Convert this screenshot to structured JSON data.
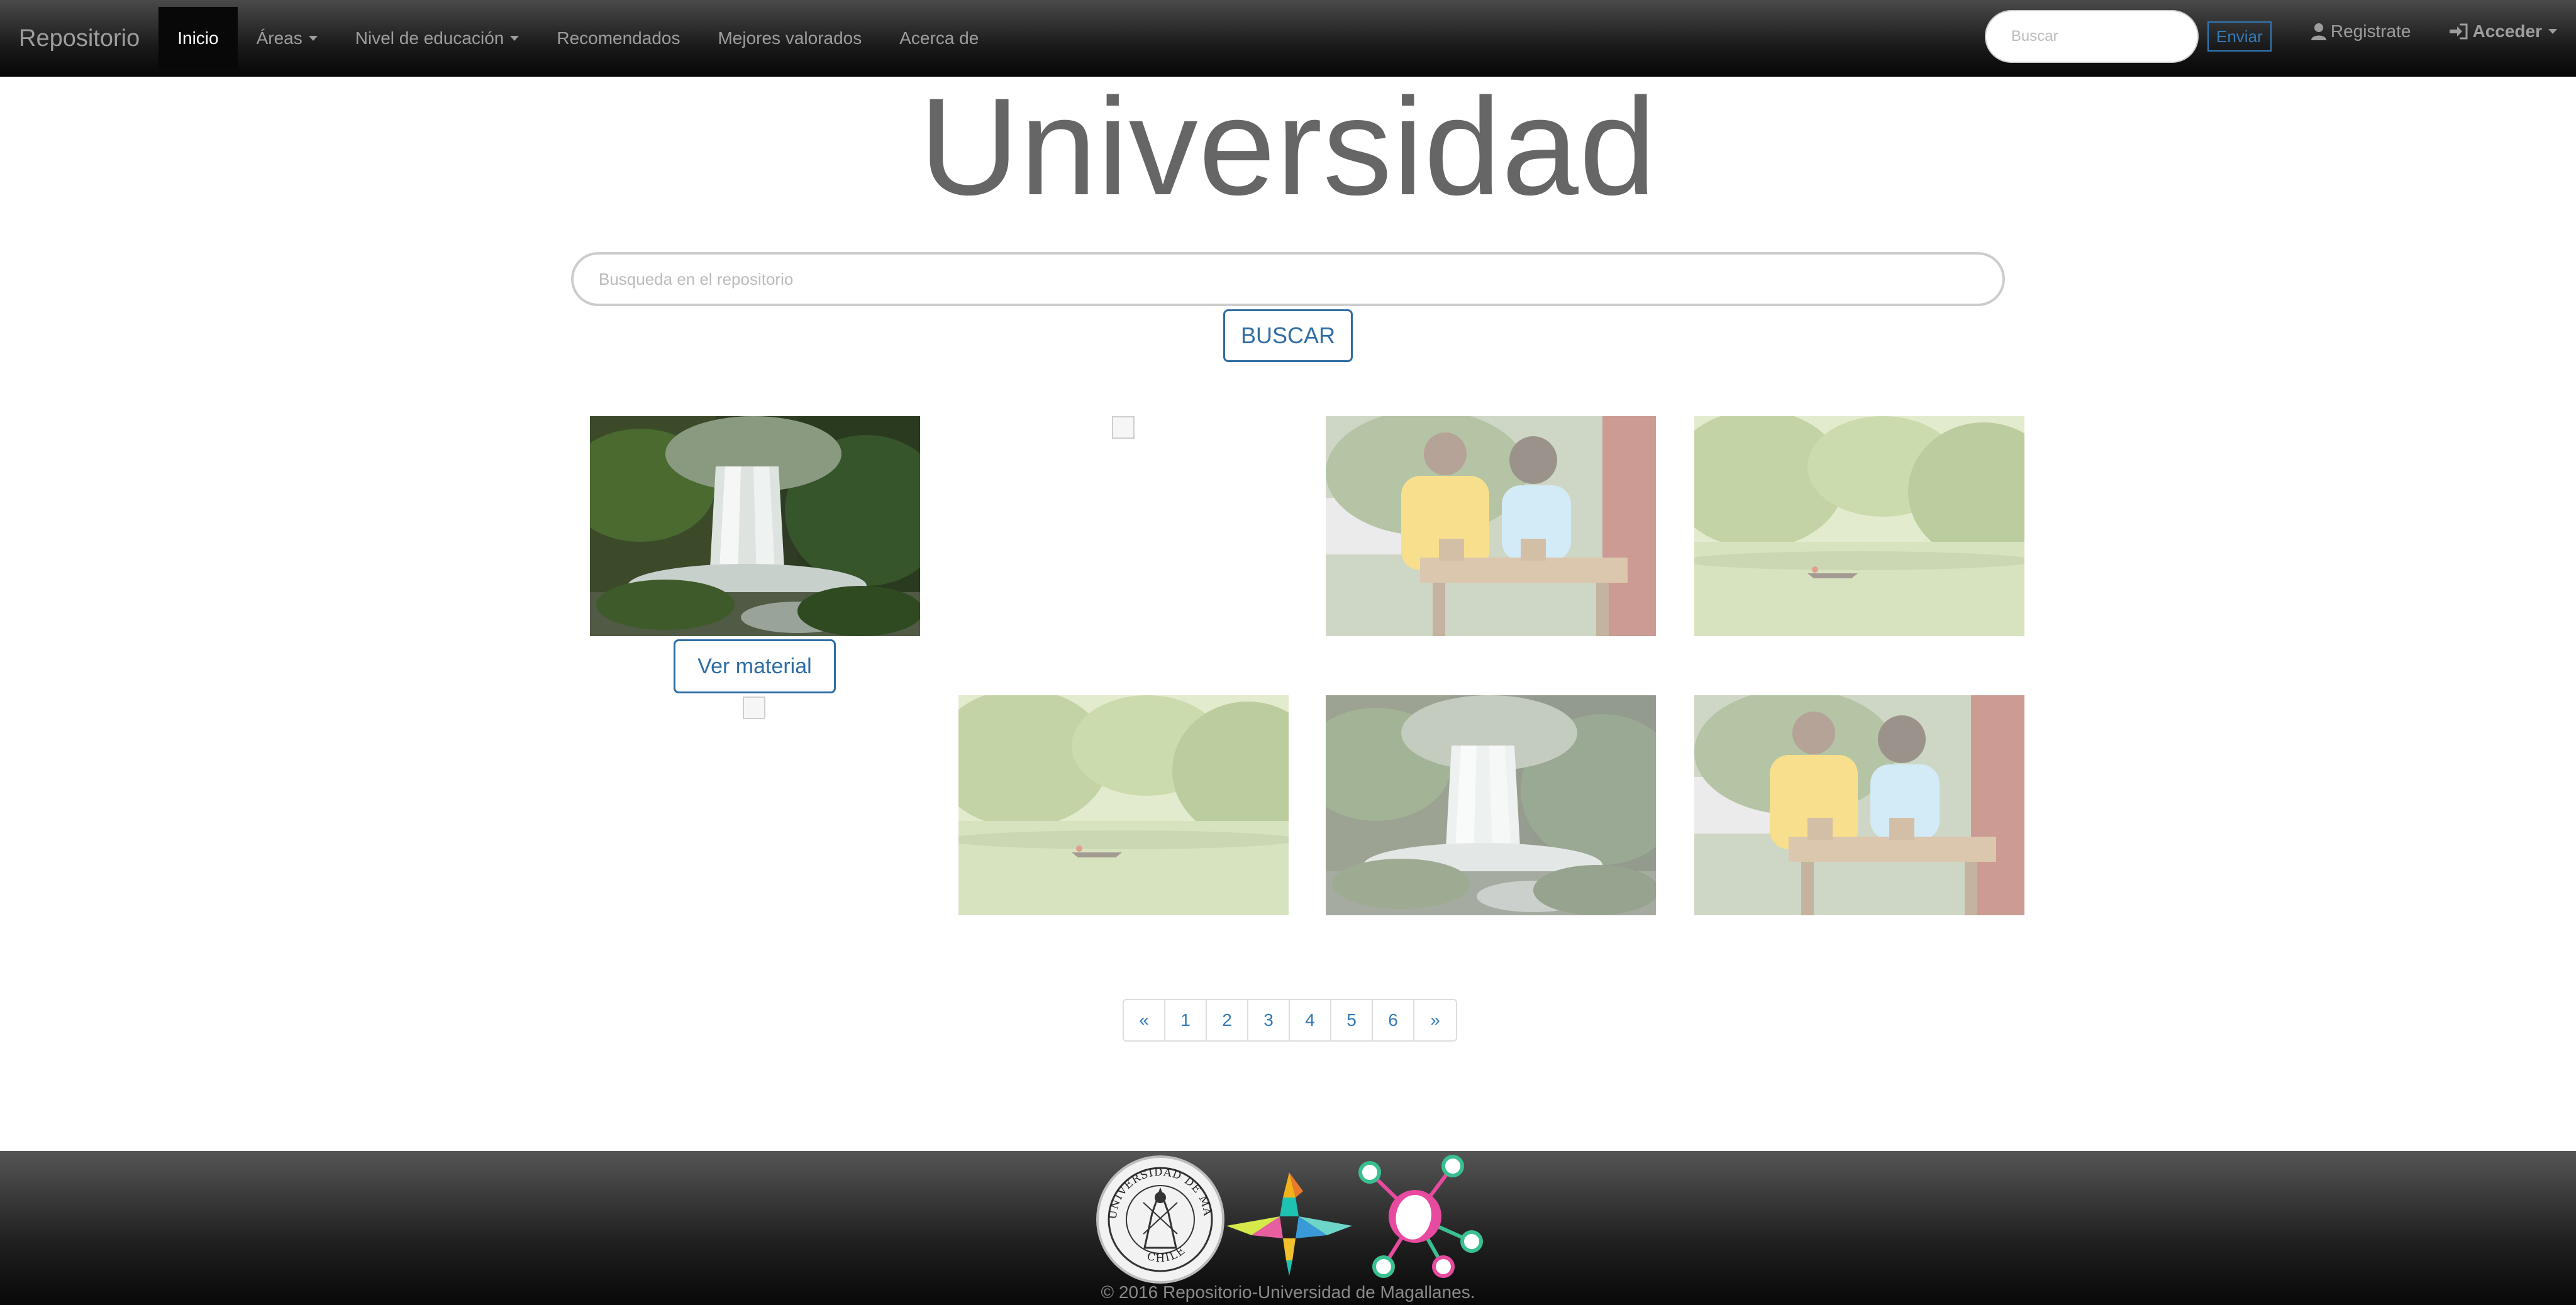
{
  "navbar": {
    "brand": "Repositorio",
    "items": [
      {
        "label": "Inicio",
        "active": true
      },
      {
        "label": "Áreas",
        "dropdown": true
      },
      {
        "label": "Nivel de educación",
        "dropdown": true
      },
      {
        "label": "Recomendados"
      },
      {
        "label": "Mejores valorados"
      },
      {
        "label": "Acerca de"
      }
    ],
    "search_placeholder": "Buscar",
    "submit_label": "Enviar",
    "register_label": "Registrate",
    "login_label": "Acceder"
  },
  "hero": {
    "title": "Universidad",
    "search_placeholder": "Busqueda en el repositorio",
    "search_button": "BUSCAR"
  },
  "grid": {
    "view_button": "Ver material",
    "cards": [
      {
        "image": "waterfall-photo",
        "faded": false
      },
      {
        "image": "broken-image",
        "faded": false
      },
      {
        "image": "children-photo",
        "faded": true
      },
      {
        "image": "lake-photo",
        "faded": true
      },
      {
        "image": "broken-image",
        "faded": false
      },
      {
        "image": "lake-photo",
        "faded": true
      },
      {
        "image": "waterfall-photo",
        "faded": true
      },
      {
        "image": "children-photo",
        "faded": true
      }
    ]
  },
  "pagination": [
    "«",
    "1",
    "2",
    "3",
    "4",
    "5",
    "6",
    "»"
  ],
  "footer": {
    "logos": [
      "universidad-de-magallanes-seal",
      "colorful-bird-logo",
      "molecule-logo"
    ],
    "seal_top_text": "UNIVERSIDAD DE MAGALLANES",
    "seal_bottom_text": "CHILE",
    "copyright": "© 2016 Repositorio-Universidad de Magallanes."
  },
  "colors": {
    "link": "#337ab7",
    "nav_bg": "#222222",
    "title": "#666666"
  }
}
